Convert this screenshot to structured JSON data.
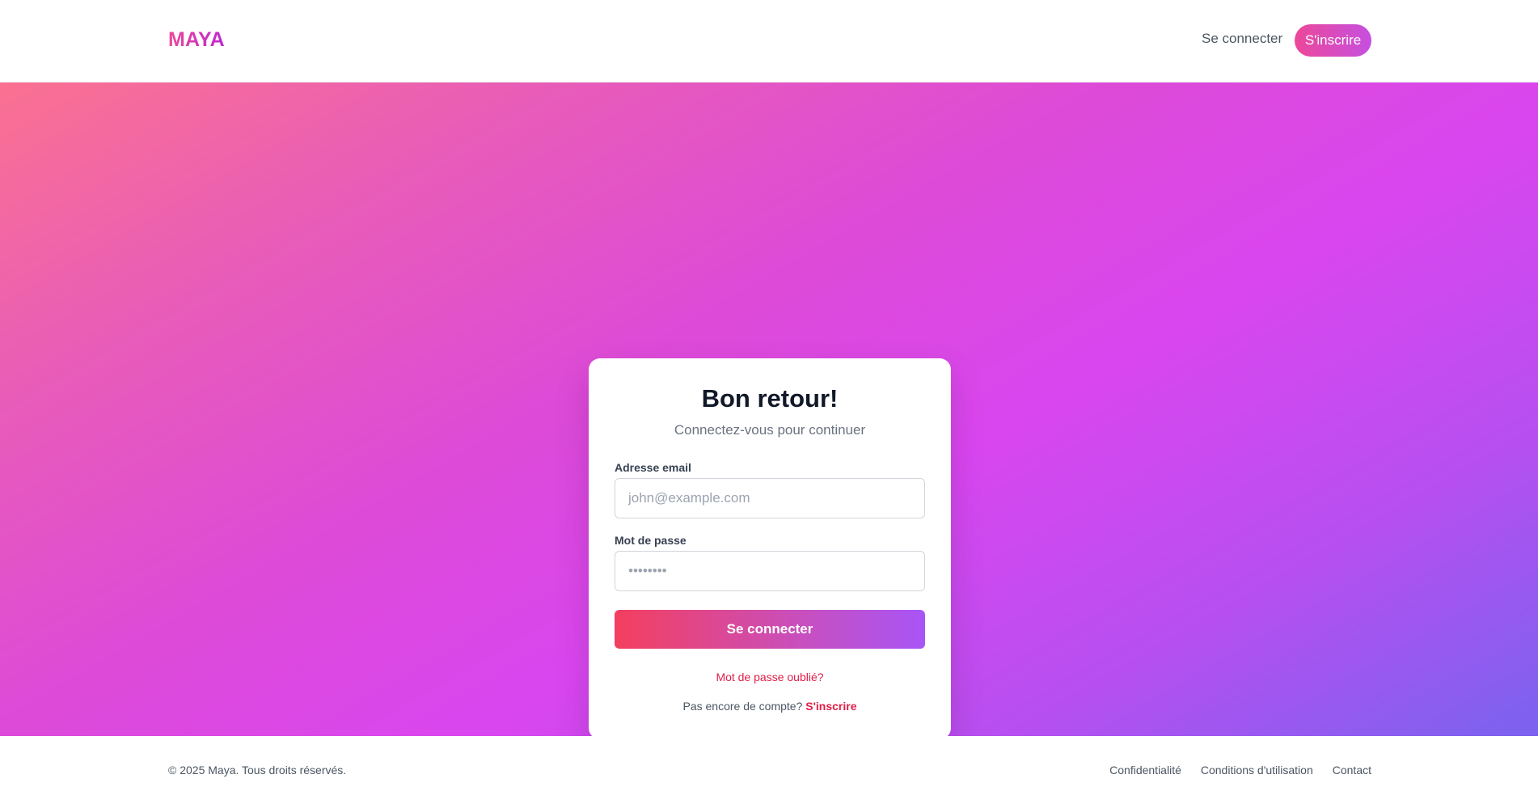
{
  "header": {
    "logo": "MAYA",
    "login_label": "Se connecter",
    "signup_label": "S'inscrire"
  },
  "login_card": {
    "title": "Bon retour!",
    "subtitle": "Connectez-vous pour continuer",
    "email_label": "Adresse email",
    "email_placeholder": "john@example.com",
    "email_value": "",
    "password_label": "Mot de passe",
    "password_placeholder": "••••••••",
    "password_value": "",
    "submit_label": "Se connecter",
    "forgot_label": "Mot de passe oublié?",
    "no_account_text": "Pas encore de compte?",
    "signup_link_label": "S'inscrire"
  },
  "footer": {
    "copyright": "© 2025 Maya. Tous droits réservés.",
    "links": [
      "Confidentialité",
      "Conditions d'utilisation",
      "Contact"
    ]
  },
  "colors": {
    "brand_pink": "#ec4899",
    "brand_purple": "#d946ef",
    "accent_red": "#e11d48",
    "gradient_start": "#fa7191",
    "gradient_end": "#7a63ef"
  }
}
